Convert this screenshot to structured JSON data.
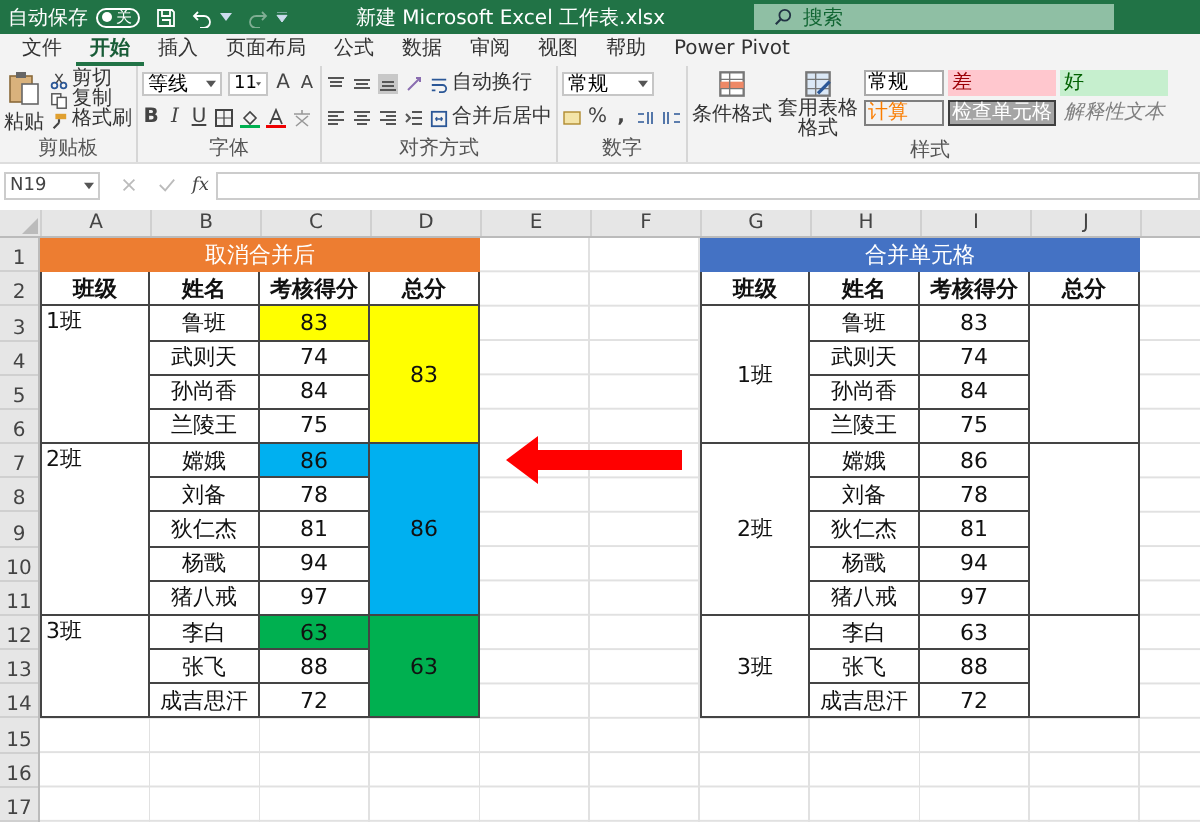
{
  "title_bar": {
    "autosave_label": "自动保存",
    "autosave_on": false,
    "autosave_state": "关",
    "filename": "新建 Microsoft Excel 工作表.xlsx",
    "search_placeholder": "搜索"
  },
  "tabs": [
    {
      "label": "文件",
      "selected": false
    },
    {
      "label": "开始",
      "selected": true
    },
    {
      "label": "插入",
      "selected": false
    },
    {
      "label": "页面布局",
      "selected": false
    },
    {
      "label": "公式",
      "selected": false
    },
    {
      "label": "数据",
      "selected": false
    },
    {
      "label": "审阅",
      "selected": false
    },
    {
      "label": "视图",
      "selected": false
    },
    {
      "label": "帮助",
      "selected": false
    },
    {
      "label": "Power Pivot",
      "selected": false
    }
  ],
  "ribbon": {
    "clipboard": {
      "paste": "粘贴",
      "cut": "剪切",
      "copy": "复制",
      "format_painter": "格式刷",
      "label": "剪贴板"
    },
    "font": {
      "name": "等线",
      "size": "11",
      "grow": "A",
      "shrink": "A",
      "bold": "B",
      "italic": "I",
      "underline": "U",
      "label": "字体"
    },
    "alignment": {
      "wrap_text": "自动换行",
      "merge_center": "合并后居中",
      "label": "对齐方式"
    },
    "number": {
      "format": "常规",
      "percent": "%",
      "comma": ",",
      "label": "数字"
    },
    "styles": {
      "conditional_formatting": "条件格式",
      "format_as_table": "套用表格格式",
      "label": "样式",
      "cell_styles": [
        {
          "label": "常规",
          "kind": "normal"
        },
        {
          "label": "差",
          "kind": "bad"
        },
        {
          "label": "好",
          "kind": "good"
        },
        {
          "label": "计算",
          "kind": "calculation"
        },
        {
          "label": "检查单元格",
          "kind": "check"
        },
        {
          "label": "解释性文本",
          "kind": "explanatory"
        }
      ]
    }
  },
  "formula_bar": {
    "name_box": "N19",
    "function_label": "fx"
  },
  "sheet": {
    "columns": [
      "A",
      "B",
      "C",
      "D",
      "E",
      "F",
      "G",
      "H",
      "I",
      "J"
    ],
    "rows": [
      "1",
      "2",
      "3",
      "4",
      "5",
      "6",
      "7",
      "8",
      "9",
      "10",
      "11",
      "12",
      "13",
      "14",
      "15",
      "16",
      "17"
    ],
    "tables": [
      {
        "title": "取消合并后",
        "merged": false,
        "headers": [
          "班级",
          "姓名",
          "考核得分",
          "总分"
        ],
        "groups": [
          {
            "class": "1班",
            "total": "83",
            "color": "#ffff00",
            "rows": [
              {
                "name": "鲁班",
                "score": "83",
                "highlighted": true
              },
              {
                "name": "武则天",
                "score": "74",
                "highlighted": false
              },
              {
                "name": "孙尚香",
                "score": "84",
                "highlighted": false
              },
              {
                "name": "兰陵王",
                "score": "75",
                "highlighted": false
              }
            ]
          },
          {
            "class": "2班",
            "total": "86",
            "color": "#00b0f0",
            "rows": [
              {
                "name": "嫦娥",
                "score": "86",
                "highlighted": true
              },
              {
                "name": "刘备",
                "score": "78",
                "highlighted": false
              },
              {
                "name": "狄仁杰",
                "score": "81",
                "highlighted": false
              },
              {
                "name": "杨戬",
                "score": "94",
                "highlighted": false
              },
              {
                "name": "猪八戒",
                "score": "97",
                "highlighted": false
              }
            ]
          },
          {
            "class": "3班",
            "total": "63",
            "color": "#00b050",
            "rows": [
              {
                "name": "李白",
                "score": "63",
                "highlighted": true
              },
              {
                "name": "张飞",
                "score": "88",
                "highlighted": false
              },
              {
                "name": "成吉思汗",
                "score": "72",
                "highlighted": false
              }
            ]
          }
        ]
      },
      {
        "title": "合并单元格",
        "merged": true,
        "headers": [
          "班级",
          "姓名",
          "考核得分",
          "总分"
        ],
        "groups": [
          {
            "class": "1班",
            "rows": [
              {
                "name": "鲁班",
                "score": "83"
              },
              {
                "name": "武则天",
                "score": "74"
              },
              {
                "name": "孙尚香",
                "score": "84"
              },
              {
                "name": "兰陵王",
                "score": "75"
              }
            ]
          },
          {
            "class": "2班",
            "rows": [
              {
                "name": "嫦娥",
                "score": "86"
              },
              {
                "name": "刘备",
                "score": "78"
              },
              {
                "name": "狄仁杰",
                "score": "81"
              },
              {
                "name": "杨戬",
                "score": "94"
              },
              {
                "name": "猪八戒",
                "score": "97"
              }
            ]
          },
          {
            "class": "3班",
            "rows": [
              {
                "name": "李白",
                "score": "63"
              },
              {
                "name": "张飞",
                "score": "88"
              },
              {
                "name": "成吉思汗",
                "score": "72"
              }
            ]
          }
        ]
      }
    ]
  }
}
